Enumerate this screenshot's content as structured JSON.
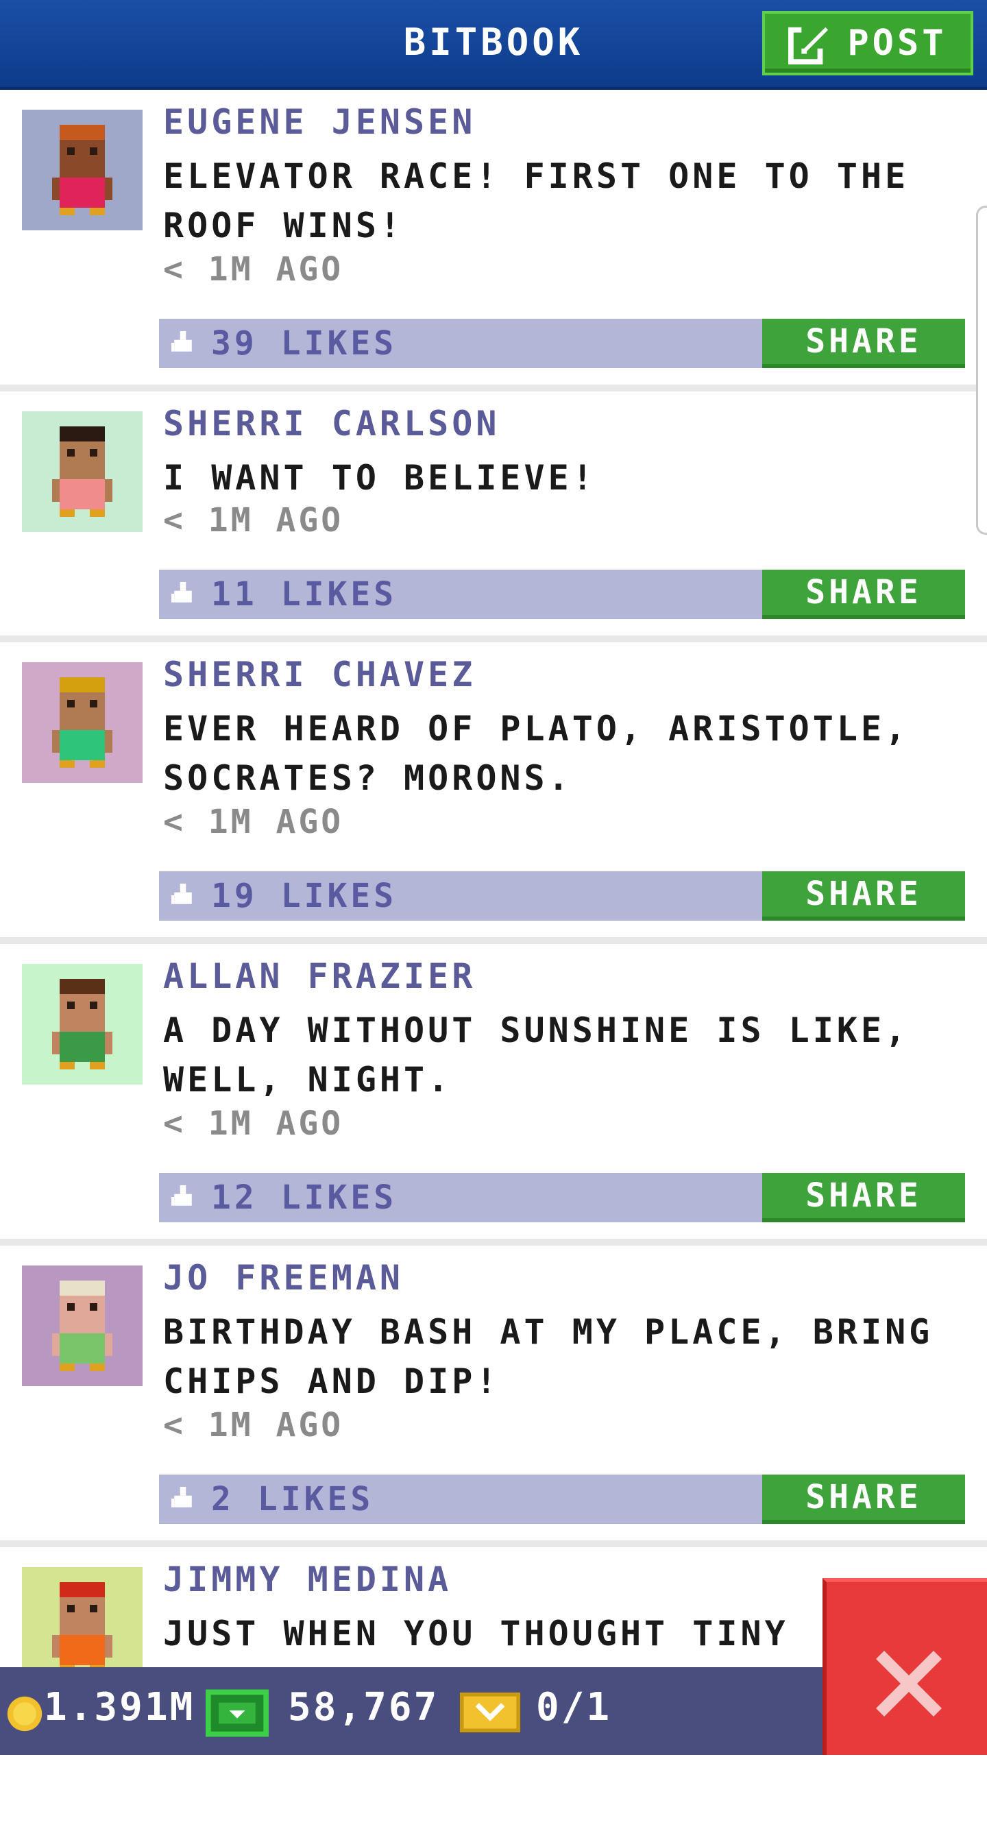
{
  "header": {
    "title": "BITBOOK",
    "post_label": "POST"
  },
  "posts": [
    {
      "author": "EUGENE JENSEN",
      "message": "ELEVATOR RACE! FIRST ONE TO THE ROOF WINS!",
      "time": "< 1M AGO",
      "likes": "39 LIKES",
      "share_label": "SHARE",
      "avatar_bg": "#9fa8c8",
      "avatar_skin": "#8a4a2a",
      "avatar_hair": "#c45a1e",
      "avatar_shirt": "#e0245a"
    },
    {
      "author": "SHERRI CARLSON",
      "message": "I WANT TO BELIEVE!",
      "time": "< 1M AGO",
      "likes": "11 LIKES",
      "share_label": "SHARE",
      "avatar_bg": "#c8ecd2",
      "avatar_skin": "#b07a52",
      "avatar_hair": "#2a1a12",
      "avatar_shirt": "#f08c8c"
    },
    {
      "author": "SHERRI CHAVEZ",
      "message": "EVER HEARD OF PLATO, ARISTOTLE, SOCRATES? MORONS.",
      "time": "< 1M AGO",
      "likes": "19 LIKES",
      "share_label": "SHARE",
      "avatar_bg": "#d0a8c8",
      "avatar_skin": "#b07a52",
      "avatar_hair": "#d4a010",
      "avatar_shirt": "#2ec47a"
    },
    {
      "author": "ALLAN FRAZIER",
      "message": "A DAY WITHOUT SUNSHINE IS LIKE, WELL, NIGHT.",
      "time": "< 1M AGO",
      "likes": "12 LIKES",
      "share_label": "SHARE",
      "avatar_bg": "#c8f4cc",
      "avatar_skin": "#c08460",
      "avatar_hair": "#5a3018",
      "avatar_shirt": "#3a9a48"
    },
    {
      "author": "JO FREEMAN",
      "message": "BIRTHDAY BASH AT MY PLACE, BRING CHIPS AND DIP!",
      "time": "< 1M AGO",
      "likes": "2 LIKES",
      "share_label": "SHARE",
      "avatar_bg": "#b898c0",
      "avatar_skin": "#e0a898",
      "avatar_hair": "#e8e0c8",
      "avatar_shirt": "#7ac46a"
    },
    {
      "author": "JIMMY MEDINA",
      "message": "JUST WHEN YOU THOUGHT TINY",
      "avatar_bg": "#d4e490",
      "avatar_skin": "#c08460",
      "avatar_hair": "#d02a1a",
      "avatar_shirt": "#f06a1a"
    }
  ],
  "statusbar": {
    "coins": "1.391M",
    "bux": "58,767",
    "tickets": "0/1"
  },
  "icons": {
    "post": "edit-icon",
    "like": "thumbs-up-icon",
    "coin": "coin-icon",
    "cash": "cash-icon",
    "ticket": "vip-ticket-icon",
    "close": "close-icon"
  },
  "colors": {
    "header": "#1a4fa6",
    "accent_green": "#3ea33a",
    "likes_bar": "#b4b6d8",
    "author": "#5b5b99",
    "close_red": "#e83a3a"
  }
}
